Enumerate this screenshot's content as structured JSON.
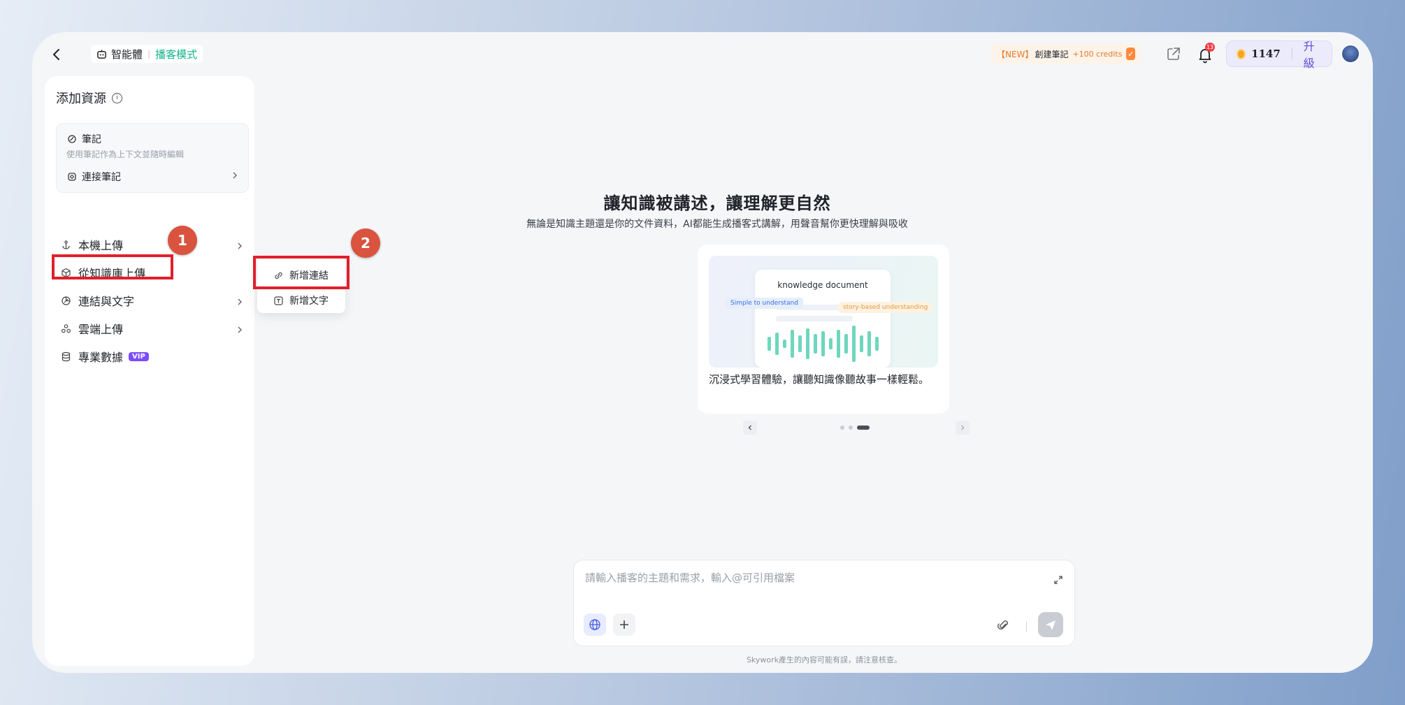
{
  "header": {
    "breadcrumb": {
      "agent": "智能體",
      "mode": "播客模式"
    },
    "promo": {
      "tag": "【NEW】",
      "text": "創建筆記",
      "credits": "+100 credits"
    },
    "notifications_count": "13",
    "credits_value": "1147",
    "upgrade_label": "升級"
  },
  "sidebar": {
    "title": "添加資源",
    "note_card": {
      "title": "筆記",
      "subtitle": "使用筆記作為上下文並隨時編輯",
      "connect_label": "連接筆記"
    },
    "items": [
      {
        "label": "本機上傳",
        "icon": "anchor-icon"
      },
      {
        "label": "從知識庫上傳",
        "icon": "cube-icon"
      },
      {
        "label": "連結與文字",
        "icon": "link-text-icon"
      },
      {
        "label": "雲端上傳",
        "icon": "cloud-icon"
      },
      {
        "label": "專業數據",
        "icon": "database-icon",
        "badge": "VIP"
      }
    ]
  },
  "submenu": {
    "items": [
      {
        "label": "新增連結",
        "icon": "link-icon"
      },
      {
        "label": "新增文字",
        "icon": "text-icon"
      }
    ]
  },
  "annotations": {
    "step1": "1",
    "step2": "2"
  },
  "hero": {
    "title": "讓知識被講述，讓理解更自然",
    "subtitle": "無論是知識主題還是你的文件資料，AI都能生成播客式講解，用聲音幫你更快理解與吸收",
    "card": {
      "doc_title": "knowledge document",
      "pill_left": "Simple to understand",
      "pill_right": "story-based understanding",
      "caption": "沉浸式學習體驗，讓聽知識像聽故事一樣輕鬆。"
    },
    "carousel": {
      "count": 3,
      "active": 2
    }
  },
  "composer": {
    "placeholder": "請輸入播客的主題和需求，輸入@可引用檔案"
  },
  "disclaimer": "Skywork產生的內容可能有誤，請注意核查。",
  "colors": {
    "accent": "#12b38a",
    "highlight": "#e0202c",
    "step": "#d9533f",
    "vip": "#7c4dff"
  }
}
